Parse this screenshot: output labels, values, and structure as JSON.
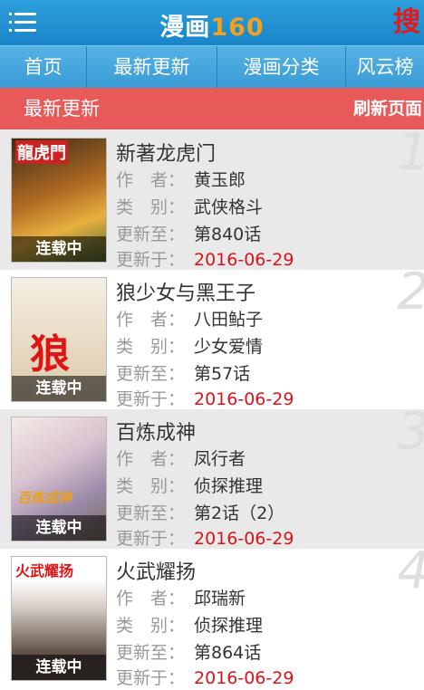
{
  "header": {
    "logo_text": "漫画",
    "logo_num": "160",
    "search_glyph": "搜"
  },
  "tabs": [
    "首页",
    "最新更新",
    "漫画分类",
    "风云榜"
  ],
  "section": {
    "title": "最新更新",
    "refresh": "刷新页面"
  },
  "labels": {
    "author": "作　者：",
    "category": "类　别：",
    "updated_to": "更新至：",
    "updated_on": "更新于："
  },
  "items": [
    {
      "rank": "1",
      "title": "新著龙虎门",
      "author": "黄玉郎",
      "category": "武侠格斗",
      "chapter": "第840话",
      "date": "2016-06-29",
      "badge": "连载中",
      "cover_text": "龍虎門"
    },
    {
      "rank": "2",
      "title": "狼少女与黑王子",
      "author": "八田鲇子",
      "category": "少女爱情",
      "chapter": "第57话",
      "date": "2016-06-29",
      "badge": "连载中",
      "cover_text": "狼"
    },
    {
      "rank": "3",
      "title": "百炼成神",
      "author": "凤行者",
      "category": "侦探推理",
      "chapter": "第2话（2）",
      "date": "2016-06-29",
      "badge": "连载中",
      "cover_text": "百炼成神"
    },
    {
      "rank": "4",
      "title": "火武耀扬",
      "author": "邱瑞新",
      "category": "侦探推理",
      "chapter": "第864话",
      "date": "2016-06-29",
      "badge": "连载中",
      "cover_text": "火武耀扬"
    }
  ]
}
